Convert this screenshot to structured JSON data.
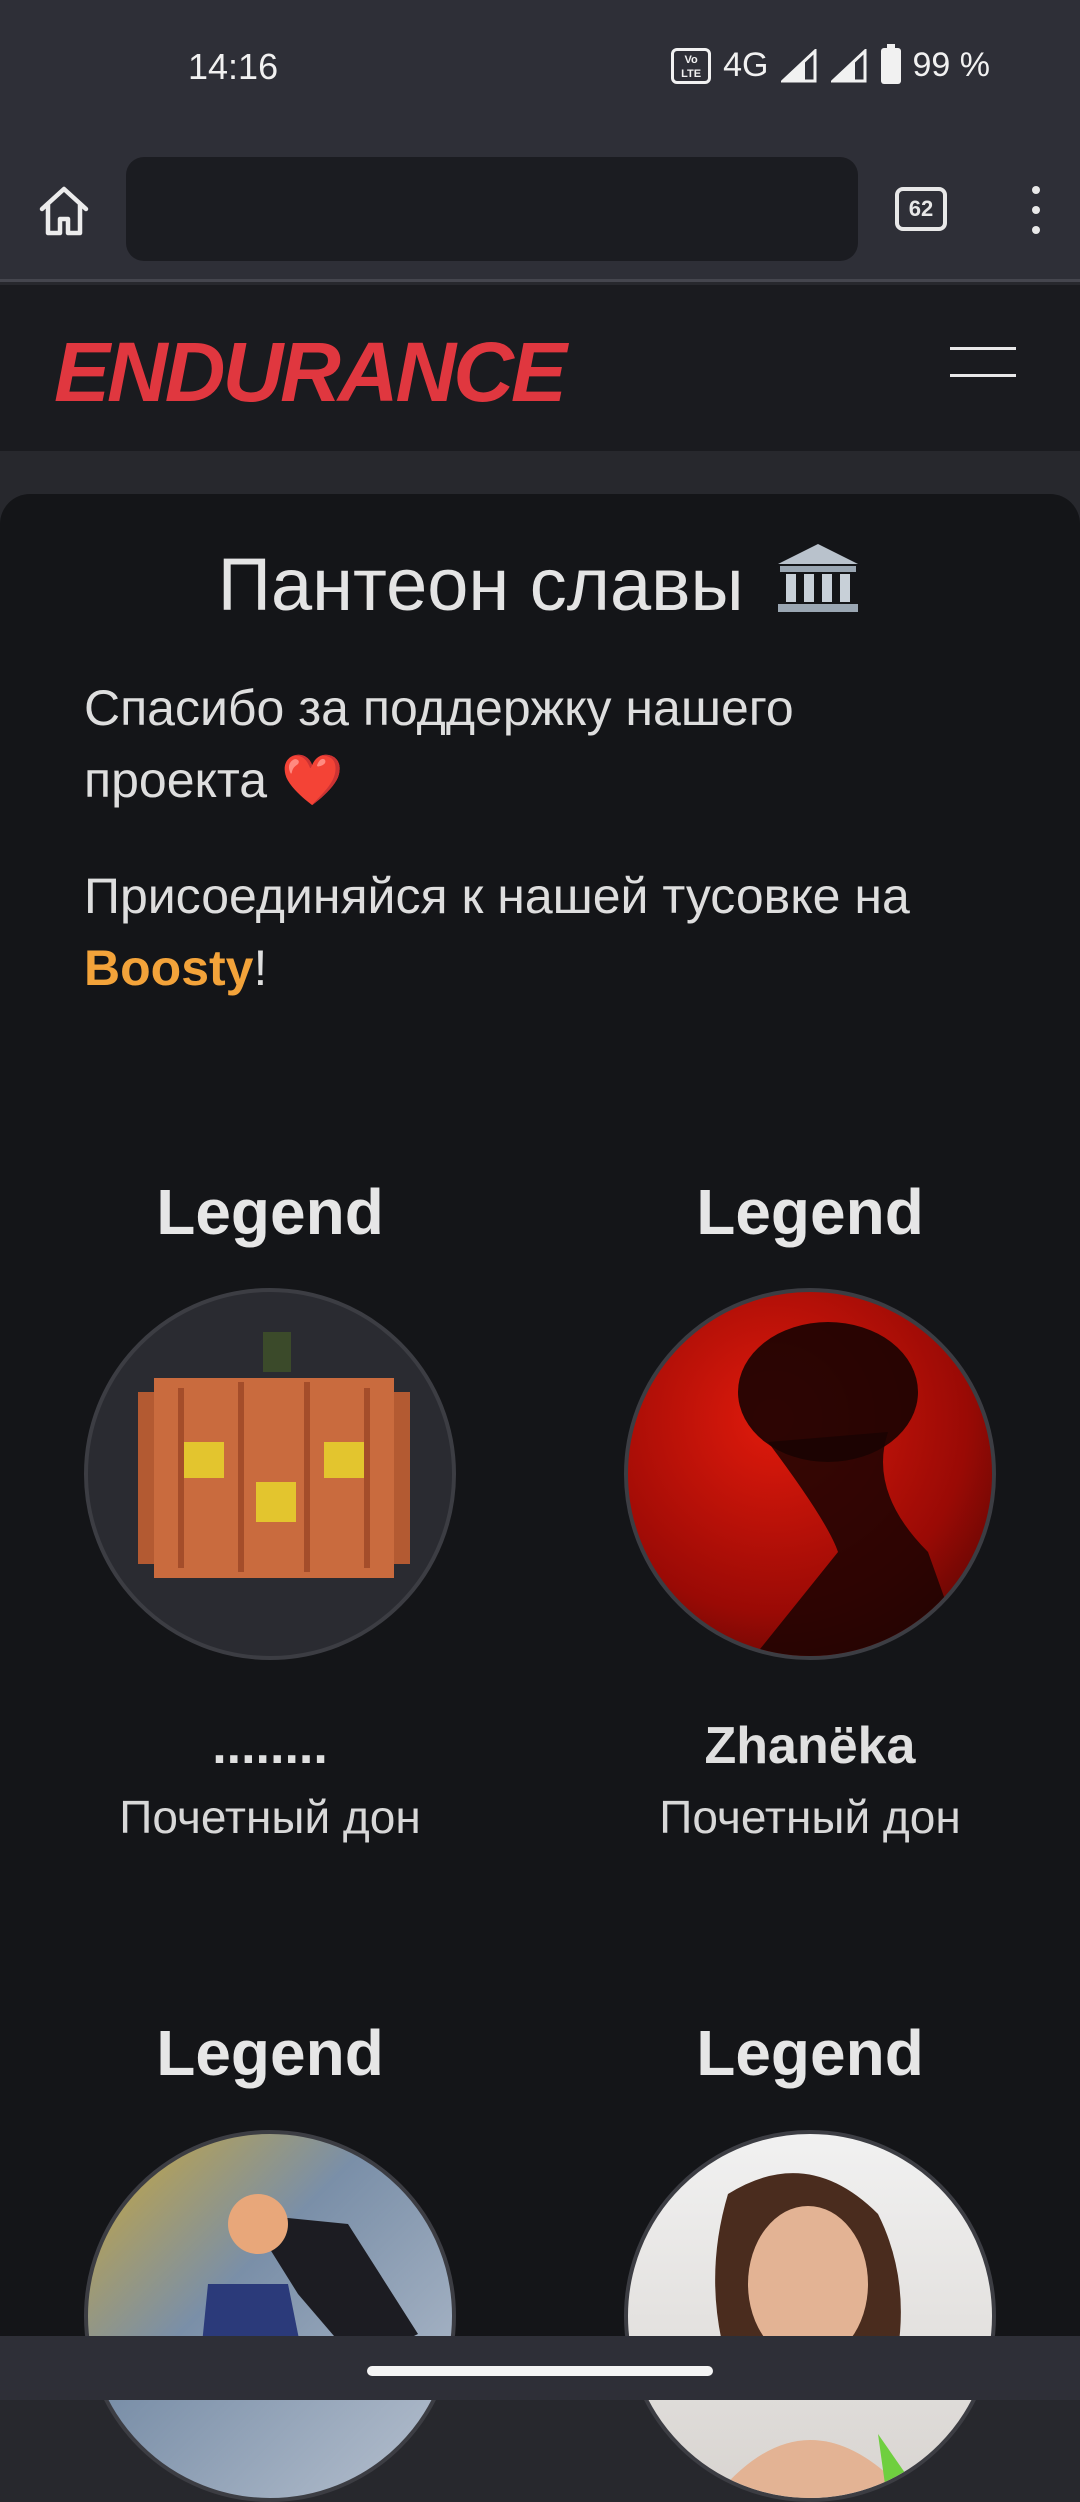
{
  "status_bar": {
    "time": "14:16",
    "network": "4G",
    "battery": "99 %",
    "volte_label": "Vo LTE"
  },
  "browser": {
    "url_value": "",
    "tab_count": "62"
  },
  "site": {
    "logo_text": "ENDURANCE"
  },
  "page": {
    "title": "Пантеон славы",
    "title_icon": "classical-building-icon",
    "thanks_text": "Спасибо за поддержку нашего проекта",
    "thanks_emoji": "❤️",
    "join_text_before": "Присоединяйся к нашей тусовке на ",
    "join_link": "Boosty",
    "join_text_after": "!"
  },
  "donors": [
    {
      "tier": "Legend",
      "name": "........",
      "role": "Почетный дон",
      "avatar": "pumpkin-pixel-icon"
    },
    {
      "tier": "Legend",
      "name": "Zhanëka",
      "role": "Почетный дон",
      "avatar": "red-silhouette-photo"
    },
    {
      "tier": "Legend",
      "avatar": "anime-figure-photo"
    },
    {
      "tier": "Legend",
      "avatar": "smiling-woman-photo"
    }
  ],
  "colors": {
    "logo_red": "#e0373f",
    "link_orange": "#f3a33a",
    "card_bg": "#141518"
  }
}
